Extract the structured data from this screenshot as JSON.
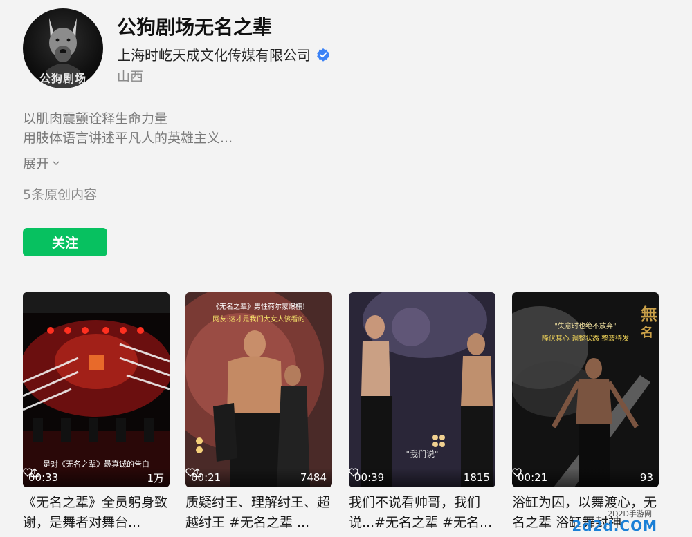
{
  "profile": {
    "title": "公狗剧场无名之辈",
    "company": "上海时屹天成文化传媒有限公司",
    "location": "山西",
    "avatar_text": "公狗剧场"
  },
  "bio": {
    "line1": "以肌肉震颤诠释生命力量",
    "line2": "用肢体语言讲述平凡人的英雄主义..."
  },
  "expand_label": "展开",
  "count_label": "5条原创内容",
  "follow_label": "关注",
  "colors": {
    "accent": "#07c160",
    "verified": "#3b82f6"
  },
  "videos": [
    {
      "duration": "00:33",
      "likes": "1万",
      "show_share": true,
      "title": "《无名之辈》全员躬身致谢，是舞者对舞台...",
      "caption": "是对《无名之辈》最真诚的告白"
    },
    {
      "duration": "00:21",
      "likes": "7484",
      "show_share": true,
      "title": "质疑纣王、理解纣王、超越纣王 #无名之辈 ...",
      "caption_top": "《无名之辈》男性荷尔蒙爆棚!",
      "caption_sub": "网友:这才是我们大女人该看的"
    },
    {
      "duration": "00:39",
      "likes": "1815",
      "show_share": false,
      "title": "我们不说看帅哥，我们说...#无名之辈 #无名...",
      "caption": "\"我们说\""
    },
    {
      "duration": "00:21",
      "likes": "93",
      "show_share": false,
      "title": "浴缸为囚，以舞渡心，无名之辈 浴缸舞封神",
      "caption_top": "\"失意时也绝不放弃\"",
      "caption_sub": "降伏其心 调整状态 整装待发"
    }
  ],
  "watermark": {
    "main": "2d2d.COM",
    "sub": "2D2D手游网"
  }
}
